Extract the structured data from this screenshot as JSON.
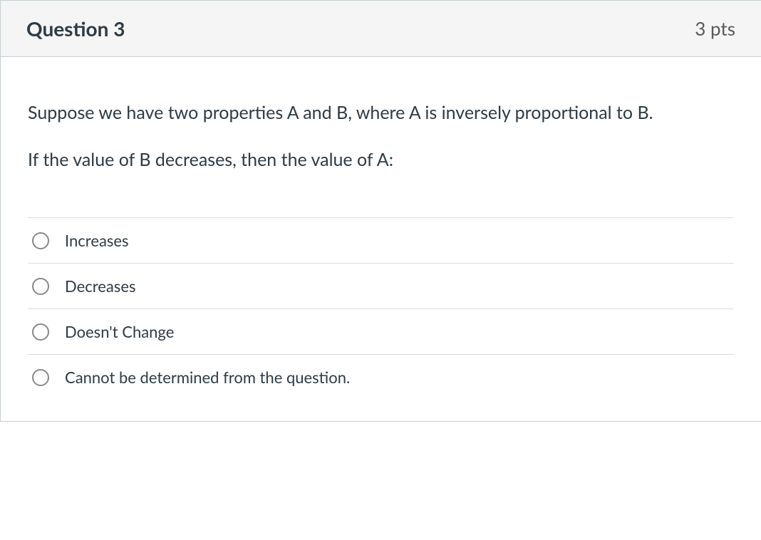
{
  "header": {
    "title": "Question 3",
    "points": "3 pts"
  },
  "body": {
    "paragraph1": "Suppose we have two properties A and B, where A is inversely proportional to B.",
    "paragraph2": "If the value of B decreases, then the value of A:"
  },
  "answers": [
    {
      "label": "Increases"
    },
    {
      "label": "Decreases"
    },
    {
      "label": "Doesn't Change"
    },
    {
      "label": "Cannot be determined from the question."
    }
  ]
}
